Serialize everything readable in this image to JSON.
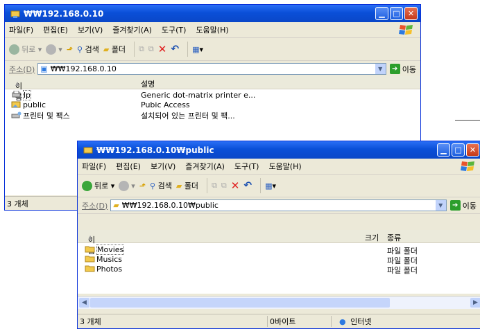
{
  "back_window": {
    "title": "₩₩192.168.0.10",
    "menu": [
      "파일(F)",
      "편집(E)",
      "보기(V)",
      "즐겨찾기(A)",
      "도구(T)",
      "도움말(H)"
    ],
    "toolbar": {
      "back": "뒤로",
      "search": "검색",
      "folders": "폴더"
    },
    "address_label": "주소(D)",
    "address_value": "₩₩192.168.0.10",
    "go_label": "이동",
    "columns": {
      "name": "이름",
      "description": "설명"
    },
    "items": [
      {
        "name": "lp",
        "description": "Generic dot-matrix printer e..."
      },
      {
        "name": "public",
        "description": "Pubic Access"
      },
      {
        "name": "프린터 및 팩스",
        "description": "설치되어 있는 프린터 및 팩..."
      }
    ],
    "status": "3 개체"
  },
  "front_window": {
    "title": "₩₩192.168.0.10₩public",
    "menu": [
      "파일(F)",
      "편집(E)",
      "보기(V)",
      "즐겨찾기(A)",
      "도구(T)",
      "도움말(H)"
    ],
    "toolbar": {
      "back": "뒤로",
      "search": "검색",
      "folders": "폴더"
    },
    "address_label": "주소(D)",
    "address_value": "₩₩192.168.0.10₩public",
    "go_label": "이동",
    "columns": {
      "name": "이름",
      "size": "크기",
      "type": "종류"
    },
    "items": [
      {
        "name": "Movies",
        "type": "파일 폴더"
      },
      {
        "name": "Musics",
        "type": "파일 폴더"
      },
      {
        "name": "Photos",
        "type": "파일 폴더"
      }
    ],
    "status": {
      "count": "3 개체",
      "size": "0바이트",
      "zone": "인터넷"
    }
  },
  "colors": {
    "title_blue": "#0a4fd8",
    "chrome": "#ece9d8",
    "folder": "#f2c94c"
  },
  "icons": [
    "folder-icon",
    "printer-icon",
    "network-icon",
    "windows-logo-icon",
    "back-icon",
    "forward-icon",
    "up-folder-icon",
    "search-icon",
    "delete-icon",
    "undo-icon",
    "views-icon",
    "globe-icon"
  ]
}
